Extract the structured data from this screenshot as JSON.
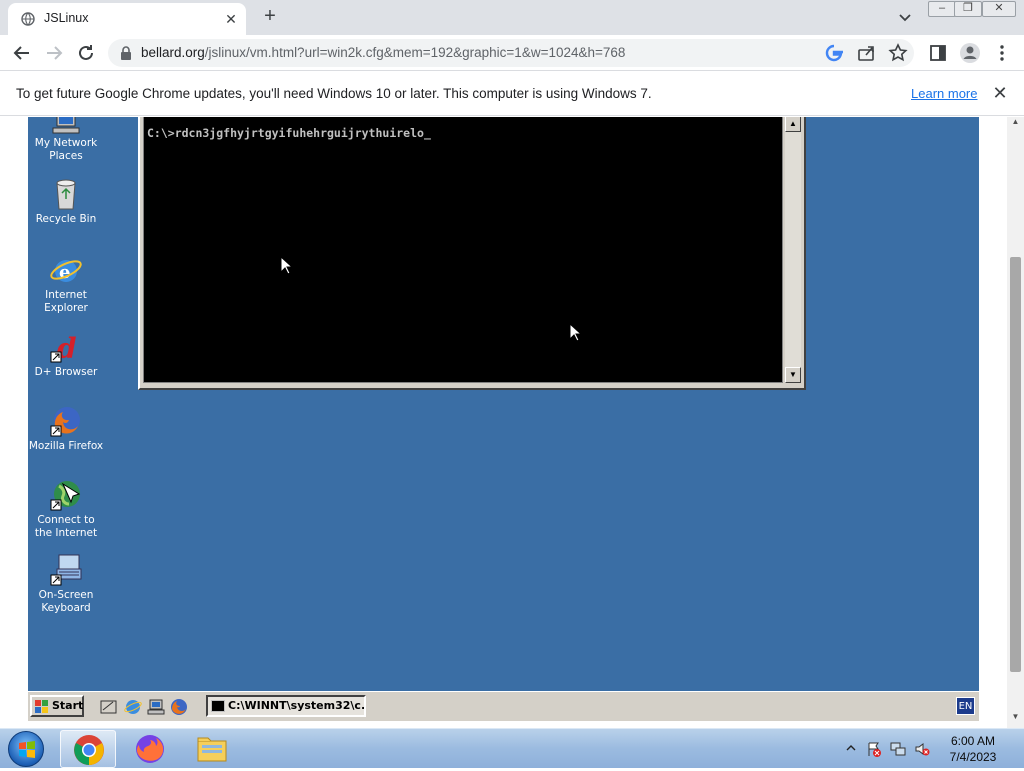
{
  "browser": {
    "tab_title": "JSLinux",
    "url_host": "bellard.org",
    "url_path": "/jslinux/vm.html?url=win2k.cfg&mem=192&graphic=1&w=1024&h=768",
    "window_buttons": {
      "minimize": "–",
      "restore": "❐",
      "close": "✕"
    },
    "new_tab": "+",
    "tab_close": "✕"
  },
  "infobar": {
    "message": "To get future Google Chrome updates, you'll need Windows 10 or later. This computer is using Windows 7.",
    "learn_more": "Learn more",
    "close": "✕"
  },
  "desktop": {
    "icons": [
      {
        "label": "My Network Places",
        "icon": "network-places-icon"
      },
      {
        "label": "Recycle Bin",
        "icon": "recycle-bin-icon"
      },
      {
        "label": "Internet Explorer",
        "icon": "internet-explorer-icon"
      },
      {
        "label": "D+ Browser",
        "icon": "dplus-browser-icon"
      },
      {
        "label": "Mozilla Firefox",
        "icon": "firefox-icon"
      },
      {
        "label": "Connect to the Internet",
        "icon": "connect-internet-icon"
      },
      {
        "label": "On-Screen Keyboard",
        "icon": "onscreen-keyboard-icon"
      }
    ],
    "console": {
      "command_line": "C:\\>rdcn3jgfhyjrtgyifuhehrguijrythuirelo_"
    }
  },
  "w2k_taskbar": {
    "start_label": "Start",
    "task_item": "C:\\WINNT\\system32\\c...",
    "language": "EN"
  },
  "win7_taskbar": {
    "time": "6:00 AM",
    "date": "7/4/2023",
    "pinned": [
      "chrome-icon",
      "firefox-icon",
      "explorer-folder-icon"
    ]
  },
  "colors": {
    "desktop_bg": "#3a6ea5",
    "console_bg": "#000000",
    "link": "#1a73e8"
  }
}
